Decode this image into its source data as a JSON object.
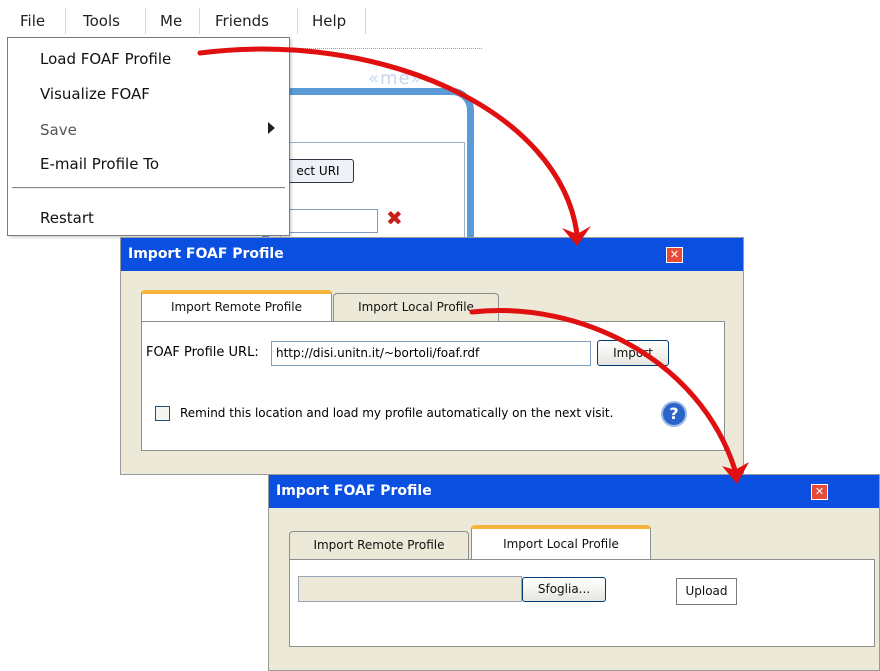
{
  "menubar": {
    "items": [
      "File",
      "Tools",
      "Me",
      "Friends",
      "Help"
    ]
  },
  "background_panel": {
    "title": "«me»",
    "button_label": "ect URI"
  },
  "file_menu": {
    "items": [
      "Load FOAF Profile",
      "Visualize FOAF",
      "Save",
      "E-mail Profile To",
      "Restart"
    ]
  },
  "dialog1": {
    "title": "Import FOAF Profile",
    "tabs": [
      "Import Remote Profile",
      "Import Local Profile"
    ],
    "url_label": "FOAF Profile URL:",
    "url_value": "http://disi.unitn.it/~bortoli/foaf.rdf",
    "import_button": "Import",
    "remember_label": "Remind this location and load my profile automatically on the next visit."
  },
  "dialog2": {
    "title": "Import FOAF Profile",
    "tabs": [
      "Import Remote Profile",
      "Import Local Profile"
    ],
    "browse_button": "Sfoglia...",
    "upload_button": "Upload"
  },
  "colors": {
    "titlebar": "#0b4fe0",
    "arrow": "#e01010",
    "tab_accent": "#f5b43c",
    "panel_border": "#5a9ad6"
  }
}
